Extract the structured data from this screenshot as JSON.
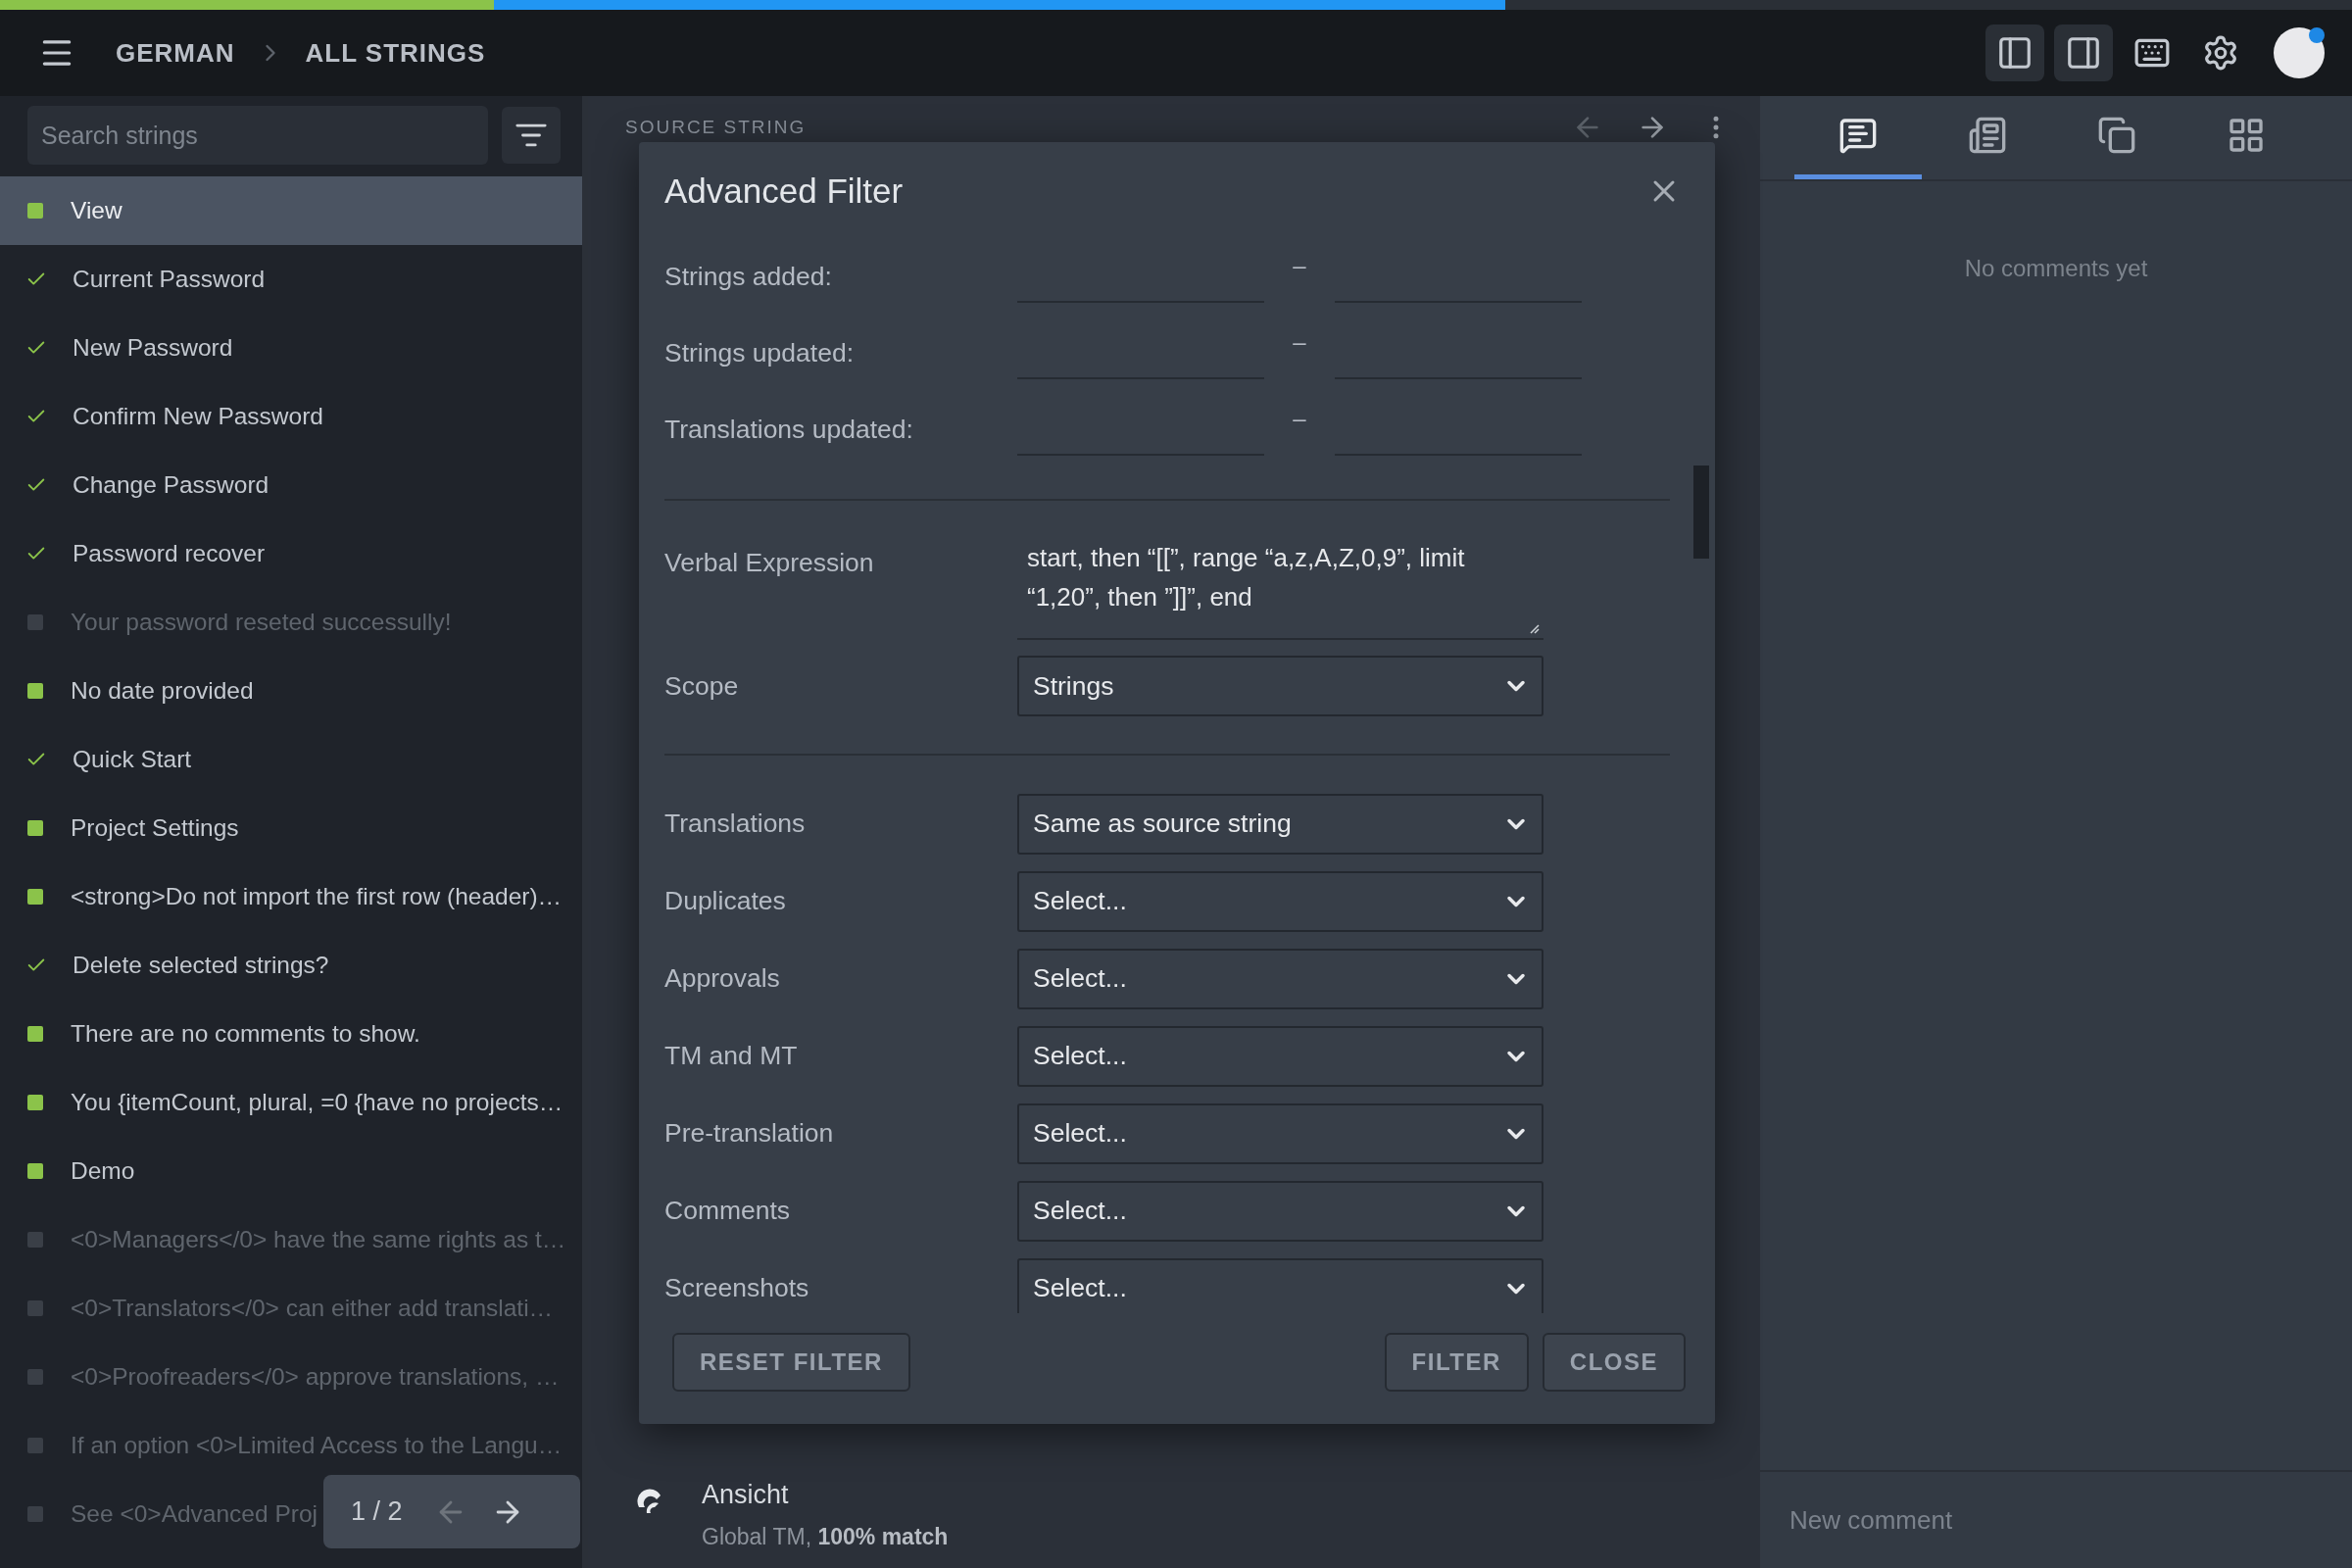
{
  "progress_bar": {
    "segments": [
      {
        "kind": "approved",
        "level": 0.21
      },
      {
        "kind": "translated",
        "level": 0.43
      }
    ]
  },
  "breadcrumb": [
    "GERMAN",
    "ALL STRINGS"
  ],
  "toolbar": {
    "buttons": [
      {
        "kind": "left-panel",
        "on": true
      },
      {
        "kind": "right-panel",
        "on": true
      },
      {
        "kind": "keyboard",
        "on": false
      },
      {
        "kind": "settings",
        "on": false
      }
    ],
    "avatar": {
      "notification": true
    }
  },
  "sidebar": {
    "search": {
      "placeholder": "Search strings"
    },
    "items": [
      {
        "text": "View",
        "kind": "translated",
        "selected": true
      },
      {
        "text": "Current Password",
        "kind": "approved",
        "selected": false
      },
      {
        "text": "New Password",
        "kind": "approved",
        "selected": false
      },
      {
        "text": "Confirm New Password",
        "kind": "approved",
        "selected": false
      },
      {
        "text": "Change Password",
        "kind": "approved",
        "selected": false
      },
      {
        "text": "Password recover",
        "kind": "approved",
        "selected": false
      },
      {
        "text": "Your password reseted successully!",
        "kind": "untranslated",
        "selected": false
      },
      {
        "text": "No date provided",
        "kind": "translated",
        "selected": false
      },
      {
        "text": "Quick Start",
        "kind": "approved",
        "selected": false
      },
      {
        "text": "Project Settings",
        "kind": "translated",
        "selected": false
      },
      {
        "text": "<strong>Do not import the first row (header)…",
        "kind": "translated",
        "selected": false
      },
      {
        "text": "Delete selected strings?",
        "kind": "approved",
        "selected": false
      },
      {
        "text": "There are no comments to show.",
        "kind": "translated",
        "selected": false
      },
      {
        "text": "You {itemCount, plural, =0 {have no projects…",
        "kind": "translated",
        "selected": false
      },
      {
        "text": "Demo",
        "kind": "translated",
        "selected": false
      },
      {
        "text": "<0>Managers</0> have the same rights as t…",
        "kind": "untranslated",
        "selected": false
      },
      {
        "text": "<0>Translators</0> can either add translati…",
        "kind": "untranslated",
        "selected": false
      },
      {
        "text": "<0>Proofreaders</0> approve translations, …",
        "kind": "untranslated",
        "selected": false
      },
      {
        "text": "If an option <0>Limited Access to the Langu…",
        "kind": "untranslated",
        "selected": false
      },
      {
        "text": "See <0>Advanced Proj",
        "kind": "untranslated",
        "selected": false
      }
    ],
    "pager": {
      "text": "1 / 2"
    }
  },
  "editor": {
    "heading": "SOURCE STRING",
    "suggestion": {
      "text": "Ansicht",
      "source": "Global TM, **100% match**"
    }
  },
  "dialog": {
    "title": "Advanced Filter",
    "date_ranges": [
      {
        "label": "Strings added:",
        "separator": "–"
      },
      {
        "label": "Strings updated:",
        "separator": "–"
      },
      {
        "label": "Translations updated:",
        "separator": "–"
      }
    ],
    "verbal_expression": {
      "label": "Verbal Expression",
      "value": "start, then “[[”, range “a,z,A,Z,0,9”, limit “1,20”, then ”]]”, end"
    },
    "scope": {
      "label": "Scope",
      "value": "Strings"
    },
    "selects": [
      {
        "label": "Translations",
        "value": "Same as source string"
      },
      {
        "label": "Duplicates",
        "value": "Select..."
      },
      {
        "label": "Approvals",
        "value": "Select..."
      },
      {
        "label": "TM and MT",
        "value": "Select..."
      },
      {
        "label": "Pre-translation",
        "value": "Select..."
      },
      {
        "label": "Comments",
        "value": "Select..."
      },
      {
        "label": "Screenshots",
        "value": "Select..."
      }
    ],
    "buttons": {
      "reset": "RESET FILTER",
      "filter": "FILTER",
      "close": "CLOSE"
    }
  },
  "comments": {
    "tabs": [
      {
        "kind": "comments",
        "selected": true
      },
      {
        "kind": "details",
        "selected": false
      },
      {
        "kind": "glossary",
        "selected": false
      },
      {
        "kind": "apps",
        "selected": false
      }
    ],
    "empty": "No comments yet",
    "input": {
      "placeholder": "New comment"
    }
  }
}
